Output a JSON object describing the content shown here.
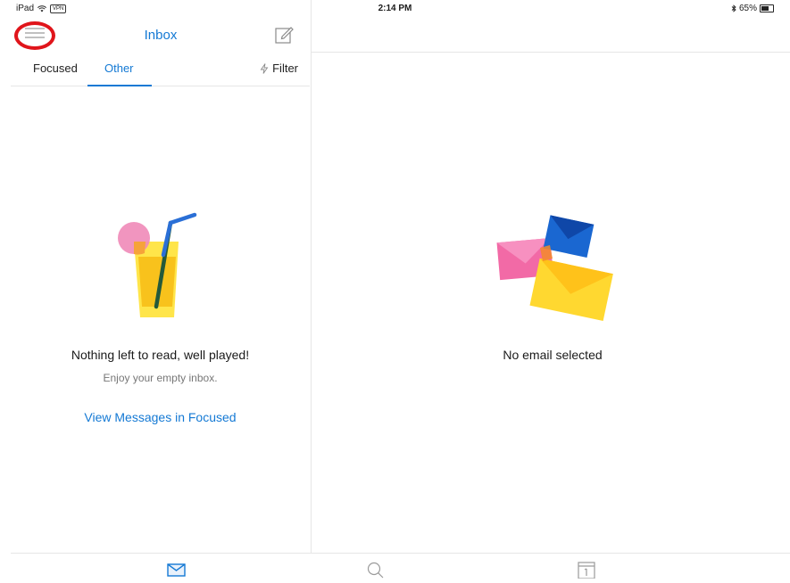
{
  "status_bar": {
    "device": "iPad",
    "vpn": "VPN",
    "time": "2:14 PM",
    "battery_percent": "65%",
    "battery_level": 0.65
  },
  "header": {
    "title": "Inbox"
  },
  "tabs": {
    "focused": "Focused",
    "other": "Other",
    "filter": "Filter",
    "active": "Other"
  },
  "empty_state": {
    "title": "Nothing left to read, well played!",
    "subtitle": "Enjoy your empty inbox.",
    "link": "View Messages in Focused"
  },
  "reading_pane": {
    "message": "No email selected"
  },
  "tabbar": {
    "items": [
      "mail-icon",
      "search-icon",
      "calendar-icon"
    ]
  },
  "colors": {
    "accent": "#1479d4",
    "annotation": "#e0151b"
  }
}
